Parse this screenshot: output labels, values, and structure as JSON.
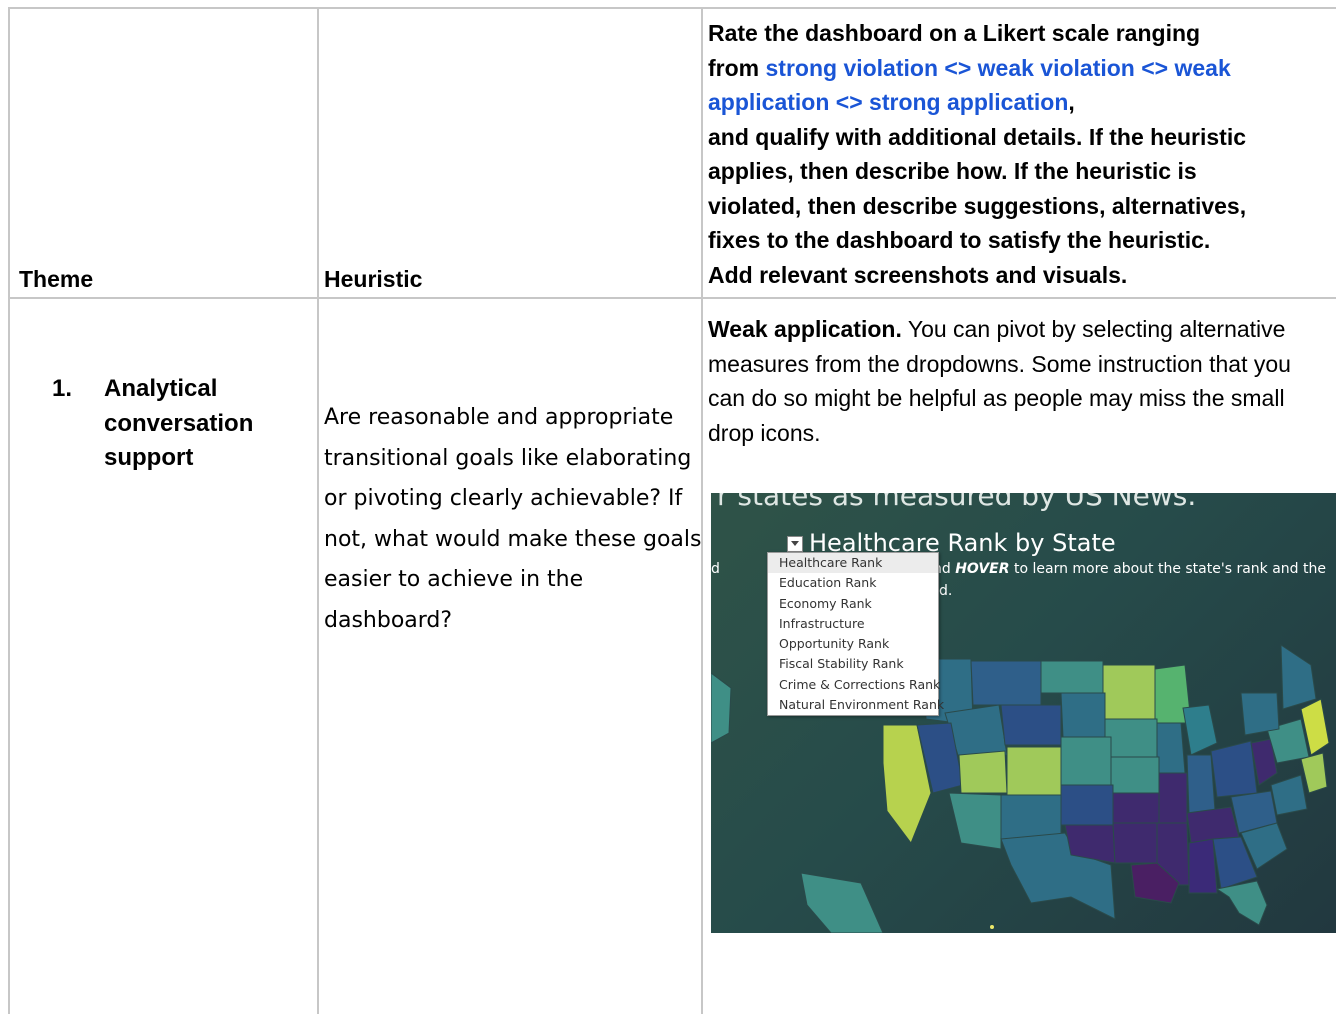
{
  "header": {
    "theme": "Theme",
    "heuristic": "Heuristic",
    "rating": {
      "line1": "Rate the dashboard on a Likert scale ranging",
      "from": "from ",
      "scale_a": "strong violation <> weak violation <> weak",
      "scale_b": "application <> strong application",
      "comma": ",",
      "line4": "and qualify with additional details. If the heuristic",
      "line5": "applies, then describe how. If the heuristic is",
      "line6": "violated, then describe suggestions, alternatives,",
      "line7": "fixes to the dashboard to satisfy the heuristic.",
      "line8": "Add relevant screenshots and visuals."
    }
  },
  "row1": {
    "number": "1.",
    "theme": "Analytical conversation support",
    "heuristic": "Are reasonable and appropriate transitional goals like elaborating or pivoting clearly achievable? If not, what would make these goals easier to achieve in the dashboard?",
    "rating_label": "Weak application.",
    "rating_text": " You can pivot by selecting alternative measures from the dropdowns. Some instruction that you can do so might be helpful as people may miss the small drop icons.",
    "screenshot": {
      "top_text": "r states as measured by US News.",
      "title": "Healthcare Rank by State",
      "left_fragment": "d",
      "sub_pre": "nd ",
      "sub_bold": "HOVER",
      "sub_post": " to learn more about the state's rank and the",
      "sub2": "d.",
      "menu": [
        "Healthcare Rank",
        "Education Rank",
        "Economy Rank",
        "Infrastructure",
        "Opportunity Rank",
        "Fiscal Stability Rank",
        "Crime & Corrections Rank",
        "Natural Environment Rank"
      ]
    }
  }
}
